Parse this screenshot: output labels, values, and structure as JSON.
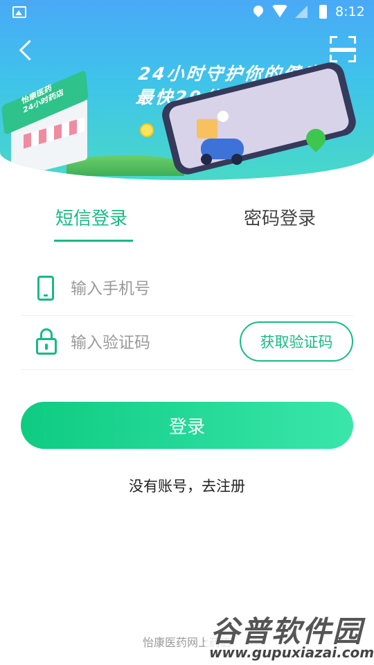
{
  "status_bar": {
    "time": "8:12"
  },
  "banner": {
    "slogan_line1": "24小时守护你的健康",
    "slogan_line2": "最快29分钟送达！",
    "shop_sign": "怡康医药\n24小时药店"
  },
  "tabs": [
    {
      "label": "短信登录",
      "active": true
    },
    {
      "label": "密码登录",
      "active": false
    }
  ],
  "form": {
    "phone_placeholder": "输入手机号",
    "phone_value": "",
    "code_placeholder": "输入验证码",
    "code_value": "",
    "get_code_label": "获取验证码"
  },
  "login_label": "登录",
  "register_link": "没有账号，去注册",
  "footer_text": "怡康医药网上药店",
  "watermark": {
    "title": "谷普软件园",
    "url": "www.gupuxiazai.com"
  },
  "colors": {
    "accent": "#18b982",
    "gradient_start": "#0ecb82",
    "gradient_end": "#3ae6ab"
  },
  "icons": [
    "image-icon",
    "location-icon",
    "wifi-icon",
    "signal-icon",
    "battery-icon",
    "back-arrow-icon",
    "scan-icon",
    "phone-icon",
    "lock-icon"
  ]
}
